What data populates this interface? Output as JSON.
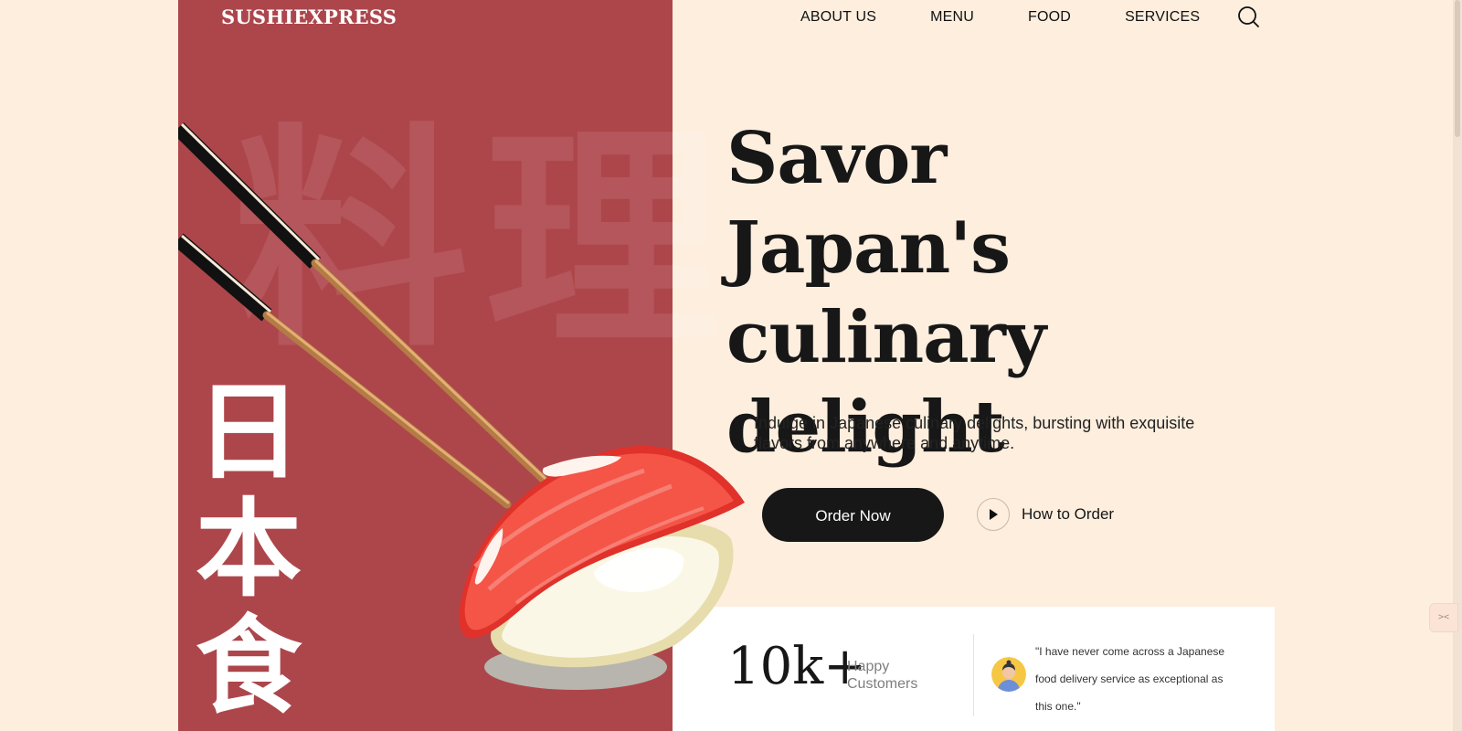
{
  "brand": {
    "name": "SUSHIEXPRESS"
  },
  "nav": {
    "items": [
      {
        "label": "ABOUT US"
      },
      {
        "label": "MENU"
      },
      {
        "label": "FOOD"
      },
      {
        "label": "SERVICES"
      }
    ],
    "search_icon": "search-icon"
  },
  "decor": {
    "background_kanji": "料理",
    "vertical_kanji": [
      "日",
      "本",
      "食"
    ]
  },
  "hero": {
    "title_lines": [
      "Savor Japan's",
      "culinary",
      "delight"
    ],
    "subtitle": "Indulge in Japanese culinary delights, bursting with exquisite flavors from anywhere and anytime.",
    "order_button": "Order Now",
    "how_to_order": "How to Order",
    "play_icon": "play-icon"
  },
  "stats": {
    "number": "10k+",
    "label": "Happy Customers",
    "quote": "\"I have never come across a Japanese food delivery service as exceptional as this one.\""
  },
  "colors": {
    "background": "#fdeede",
    "panel": "#ad464b",
    "dark": "#171717",
    "white": "#ffffff"
  }
}
